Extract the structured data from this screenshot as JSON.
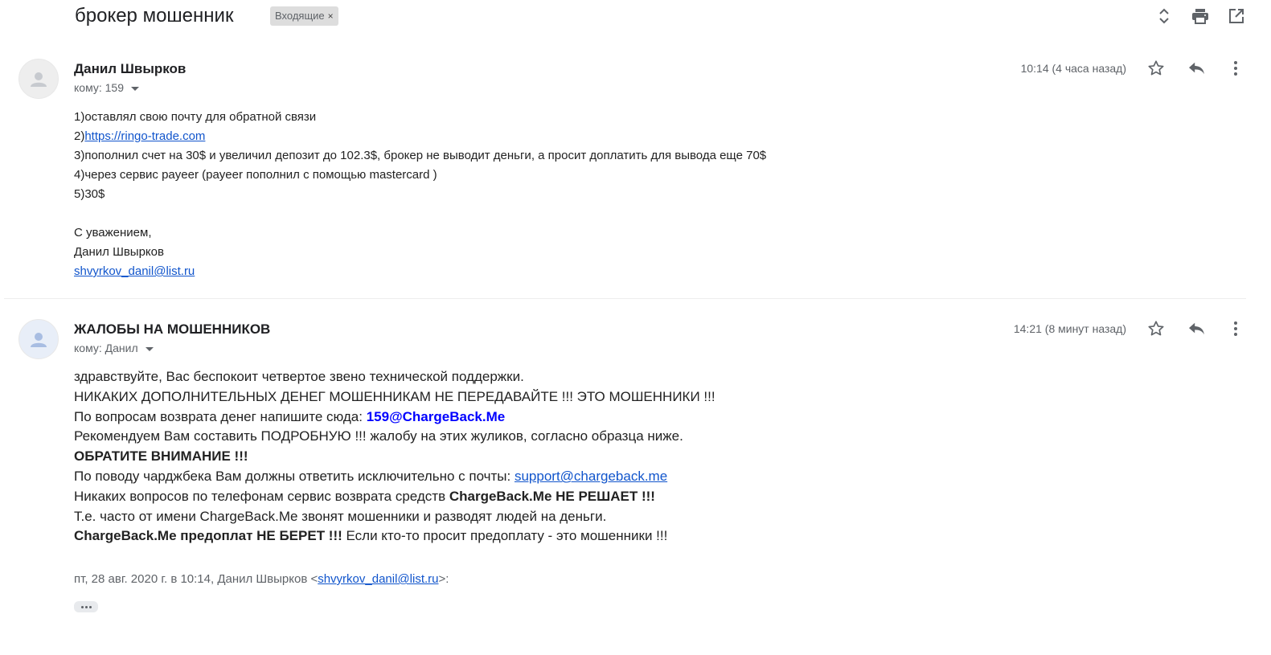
{
  "thread": {
    "subject": "брокер мошенник",
    "label": "Входящие",
    "label_close": "×"
  },
  "header_icons": [
    "expand-collapse-icon",
    "print-icon",
    "open-in-new-window-icon"
  ],
  "messages": [
    {
      "sender": "Данил Швырков",
      "recipient_prefix": "кому:",
      "recipient": "159",
      "time": "10:14 (4 часа назад)",
      "body": {
        "l1": "1)оставлял свою почту для обратной связи",
        "l2_prefix": "2)",
        "l2_link": "https://ringo-trade.com",
        "l3": "3)пополнил счет на 30$ и увеличил депозит до 102.3$, брокер не выводит деньги, а просит доплатить для вывода еще 70$",
        "l4": "4)через сервис payeer (payeer пополнил с помощью mastercard )",
        "l5": "5)30$",
        "sig1": "С уважением,",
        "sig2": "Данил Швырков",
        "sig_email": "shvyrkov_danil@list.ru"
      }
    },
    {
      "sender": "ЖАЛОБЫ НА МОШЕННИКОВ",
      "recipient_prefix": "кому:",
      "recipient": "Данил",
      "time": "14:21 (8 минут назад)",
      "body": {
        "l1": "здравствуйте, Вас беспокоит четвертое звено технической поддержки.",
        "l2": "НИКАКИХ ДОПОЛНИТЕЛЬНЫХ ДЕНЕГ МОШЕННИКАМ НЕ ПЕРЕДАВАЙТЕ !!! ЭТО МОШЕННИКИ !!!",
        "l3_text": "По вопросам возврата денег напишите сюда: ",
        "l3_email": "159@ChargeBack.Me",
        "l4": "Рекомендуем Вам составить ПОДРОБНУЮ !!! жалобу на этих жуликов, согласно образца ниже.",
        "l5": "ОБРАТИТЕ ВНИМАНИЕ !!!",
        "l6_text": "По поводу чарджбека Вам должны ответить исключительно с почты: ",
        "l6_email": "support@chargeback.me",
        "l7_text": "Никаких вопросов по телефонам сервис возврата средств ",
        "l7_bold": "ChargeBack.Me НЕ РЕШАЕТ !!!",
        "l8": "Т.е. часто от имени ChargeBack.Me звонят мошенники и разводят людей на деньги.",
        "l9_bold": "ChargeBack.Me предоплат НЕ БЕРЕТ !!!",
        "l9_text": " Если кто-то просит предоплату - это мошенники !!!"
      },
      "quote_prefix": "пт, 28 авг. 2020 г. в 10:14, Данил Швырков <",
      "quote_email": "shvyrkov_danil@list.ru",
      "quote_suffix": ">:"
    }
  ]
}
